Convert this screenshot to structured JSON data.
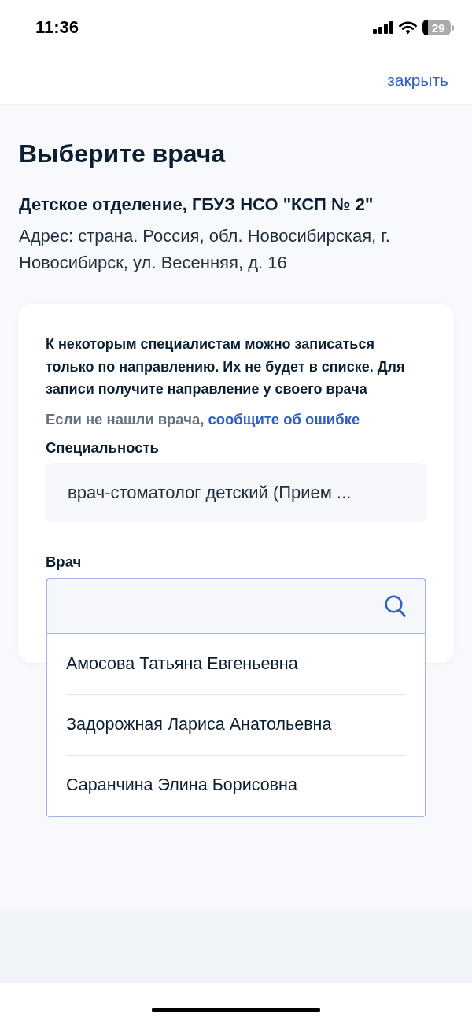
{
  "status_bar": {
    "time": "11:36",
    "battery": "29"
  },
  "header": {
    "close_link": "закрыть"
  },
  "page": {
    "title": "Выберите врача",
    "clinic": "Детское отделение, ГБУЗ НСО \"КСП № 2\"",
    "address": "Адрес: страна. Россия, обл. Новосибирская, г. Новосибирск, ул. Весенняя, д. 16"
  },
  "card": {
    "notice": "К некоторым специалистам можно записаться только по направлению. Их не будет в списке. Для записи получите направление у своего врача",
    "hint": {
      "text": "Если не нашли врача,",
      "link": "сообщите об ошибке"
    },
    "specialty": {
      "label": "Специальность",
      "value": "врач-стоматолог детский (Прием ..."
    },
    "doctor": {
      "label": "Врач",
      "expanded": true,
      "options": [
        {
          "name": "Амосова Татьяна Евгеньевна",
          "selected": false
        },
        {
          "name": "Задорожная Лариса Анатольевна",
          "selected": false
        },
        {
          "name": "Саранчина Элина Борисовна",
          "selected": false
        }
      ]
    }
  }
}
